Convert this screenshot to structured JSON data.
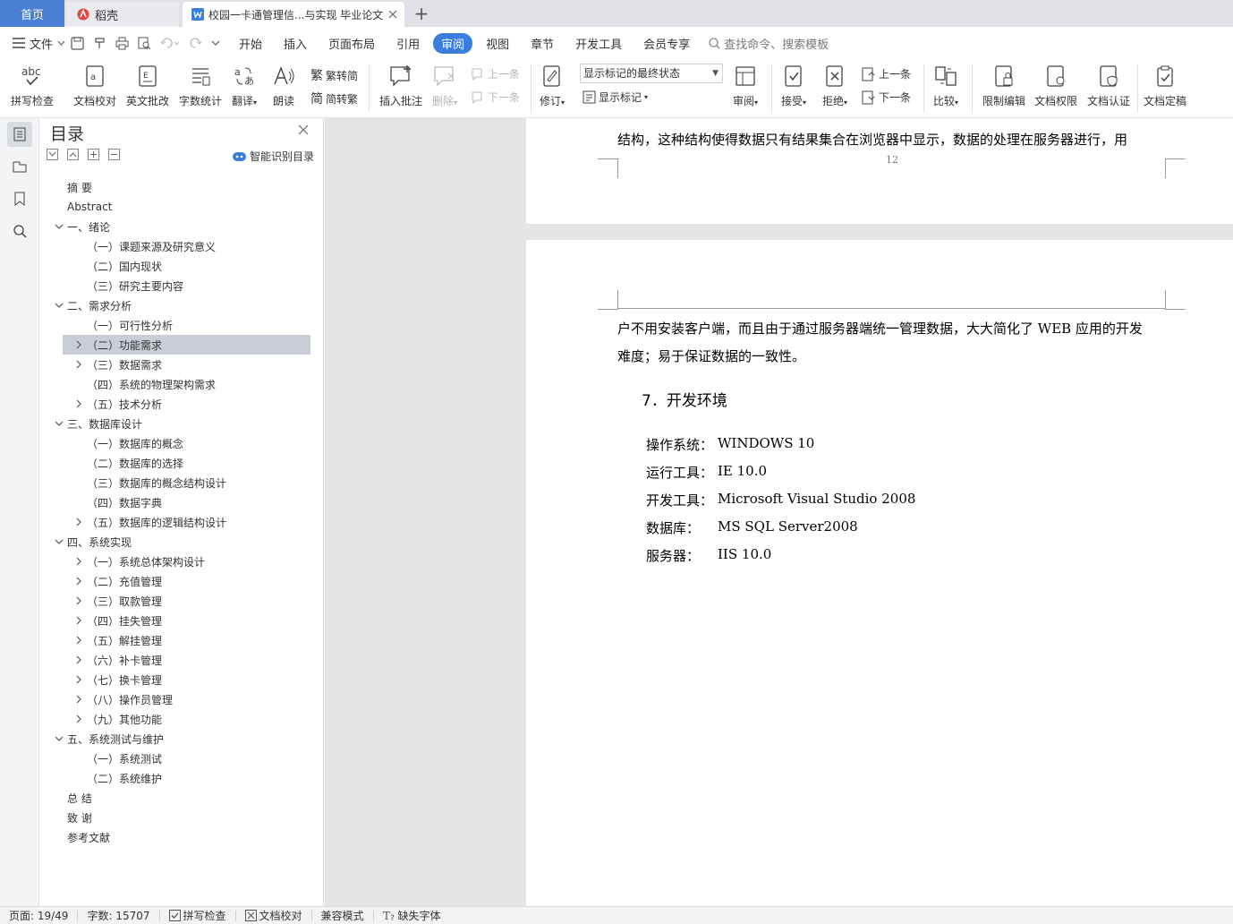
{
  "tabs": {
    "home": "首页",
    "daoke": "稻壳",
    "doc": "校园一卡通管理信...与实现 毕业论文",
    "new_tab_glyph": "+"
  },
  "menu": {
    "file": "文件",
    "items": [
      "开始",
      "插入",
      "页面布局",
      "引用",
      "审阅",
      "视图",
      "章节",
      "开发工具",
      "会员专享"
    ],
    "active": "审阅",
    "search_placeholder": "查找命令、搜索模板"
  },
  "ribbon": {
    "spell_check": "拼写检查",
    "doc_proof": "文档校对",
    "en_review": "英文批改",
    "word_count": "字数统计",
    "translate": "翻译",
    "read_aloud": "朗读",
    "trad_to_simp": "繁转简",
    "simp_to_trad": "简转繁",
    "insert_comment": "插入批注",
    "delete": "删除",
    "prev_comment": "上一条",
    "next_comment": "下一条",
    "revise": "修订",
    "markup_state": "显示标记的最终状态",
    "show_markup": "显示标记",
    "review": "审阅",
    "accept": "接受",
    "reject": "拒绝",
    "prev_change": "上一条",
    "next_change": "下一条",
    "compare": "比较",
    "restrict_edit": "限制编辑",
    "doc_permission": "文档权限",
    "doc_cert": "文档认证",
    "doc_finalize": "文档定稿"
  },
  "toc": {
    "title": "目录",
    "smart_label": "智能识别目录",
    "items": [
      {
        "label": "摘  要",
        "level": 0,
        "arrow": ""
      },
      {
        "label": "Abstract",
        "level": 0,
        "arrow": ""
      },
      {
        "label": "一、绪论",
        "level": 1,
        "arrow": "down"
      },
      {
        "label": "（一）课题来源及研究意义",
        "level": 2,
        "arrow": ""
      },
      {
        "label": "（二）国内现状",
        "level": 2,
        "arrow": ""
      },
      {
        "label": "（三）研究主要内容",
        "level": 2,
        "arrow": ""
      },
      {
        "label": "二、需求分析",
        "level": 1,
        "arrow": "down"
      },
      {
        "label": "（一）可行性分析",
        "level": 2,
        "arrow": ""
      },
      {
        "label": "（二）功能需求",
        "level": 2,
        "arrow": "right",
        "selected": true
      },
      {
        "label": "（三）数据需求",
        "level": 2,
        "arrow": "right"
      },
      {
        "label": "（四）系统的物理架构需求",
        "level": 2,
        "arrow": ""
      },
      {
        "label": "（五）技术分析",
        "level": 2,
        "arrow": "right"
      },
      {
        "label": "三、数据库设计",
        "level": 1,
        "arrow": "down"
      },
      {
        "label": "（一）数据库的概念",
        "level": 2,
        "arrow": ""
      },
      {
        "label": "（二）数据库的选择",
        "level": 2,
        "arrow": ""
      },
      {
        "label": "（三）数据库的概念结构设计",
        "level": 2,
        "arrow": ""
      },
      {
        "label": "（四）数据字典",
        "level": 2,
        "arrow": ""
      },
      {
        "label": "（五）数据库的逻辑结构设计",
        "level": 2,
        "arrow": "right"
      },
      {
        "label": "四、系统实现",
        "level": 1,
        "arrow": "down"
      },
      {
        "label": "（一）系统总体架构设计",
        "level": 2,
        "arrow": "right"
      },
      {
        "label": "（二）充值管理",
        "level": 2,
        "arrow": "right"
      },
      {
        "label": "（三）取款管理",
        "level": 2,
        "arrow": "right"
      },
      {
        "label": "（四）挂失管理",
        "level": 2,
        "arrow": "right"
      },
      {
        "label": "（五）解挂管理",
        "level": 2,
        "arrow": "right"
      },
      {
        "label": "（六）补卡管理",
        "level": 2,
        "arrow": "right"
      },
      {
        "label": "（七）换卡管理",
        "level": 2,
        "arrow": "right"
      },
      {
        "label": "（八）操作员管理",
        "level": 2,
        "arrow": "right"
      },
      {
        "label": "（九）其他功能",
        "level": 2,
        "arrow": "right"
      },
      {
        "label": "五、系统测试与维护",
        "level": 1,
        "arrow": "down"
      },
      {
        "label": "（一）系统测试",
        "level": 2,
        "arrow": ""
      },
      {
        "label": "（二）系统维护",
        "level": 2,
        "arrow": ""
      },
      {
        "label": "总  结",
        "level": 0,
        "arrow": ""
      },
      {
        "label": "致  谢",
        "level": 0,
        "arrow": ""
      },
      {
        "label": "参考文献",
        "level": 0,
        "arrow": ""
      }
    ]
  },
  "document": {
    "page1_last_line": "结构，这种结构使得数据只有结果集合在浏览器中显示，数据的处理在服务器进行，用",
    "page_number": "12",
    "page2_line1": "户不用安装客户端，而且由于通过服务器端统一管理数据，大大简化了 WEB 应用的开发",
    "page2_line2": "难度；易于保证数据的一致性。",
    "heading": "7．开发环境",
    "env": [
      {
        "key": "操作系统：",
        "value": "WINDOWS 10"
      },
      {
        "key": "运行工具：",
        "value": "IE 10.0"
      },
      {
        "key": "开发工具：",
        "value": "Microsoft Visual Studio 2008"
      },
      {
        "key": "数据库：",
        "value": "MS SQL Server2008"
      },
      {
        "key": "服务器：",
        "value": "IIS 10.0"
      }
    ]
  },
  "status": {
    "page": "页面: 19/49",
    "words": "字数: 15707",
    "spell": "拼写检查",
    "proof": "文档校对",
    "compat": "兼容模式",
    "missing_font": "缺失字体"
  },
  "colors": {
    "accent": "#3b7ddd",
    "home_tab": "#4a7fd4",
    "selected_toc": "#c9ced6",
    "doc_background": "#e5e5e5"
  }
}
